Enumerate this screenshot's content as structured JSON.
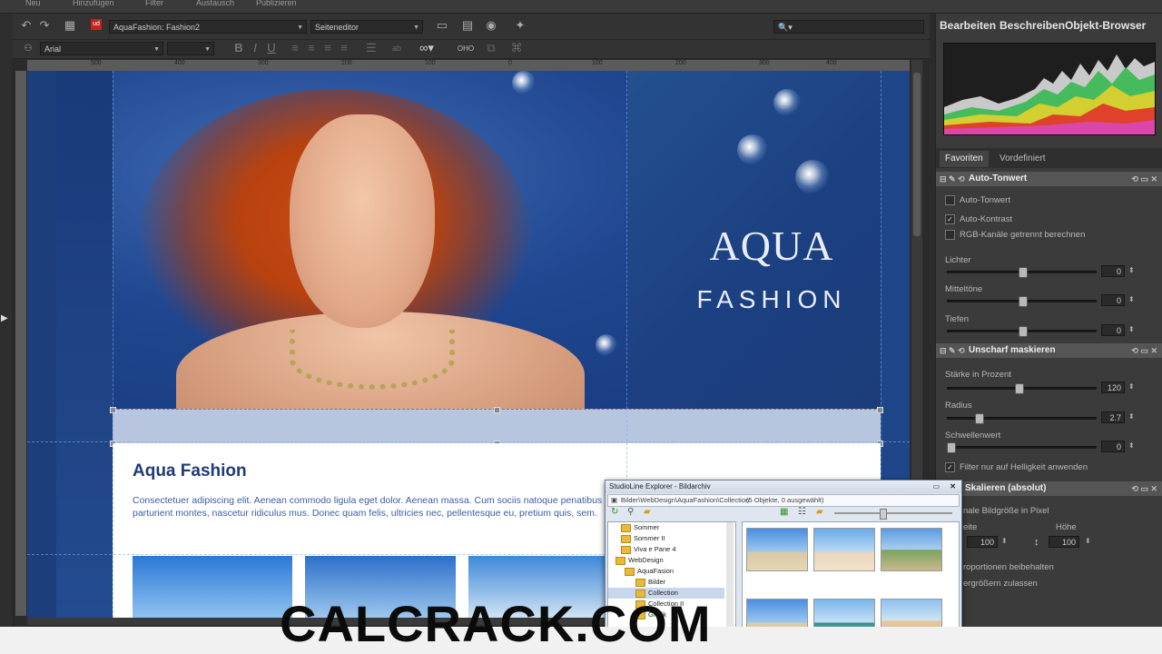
{
  "menubar": {
    "items": [
      "Neu",
      "Hinzufügen",
      "Filter",
      "Austausch",
      "Publizieren"
    ]
  },
  "toolbar": {
    "document_name": "AquaFashion: Fashion2",
    "mode": "Seiteneditor",
    "font": "Arial",
    "ruler_marks": [
      "500",
      "400",
      "300",
      "200",
      "100",
      "0",
      "100",
      "200",
      "300",
      "400"
    ]
  },
  "canvas": {
    "logo_line1": "AQUA",
    "logo_line2": "FASHION",
    "content_title": "Aqua Fashion",
    "content_text": "Consectetuer adipiscing elit. Aenean commodo ligula eget dolor. Aenean massa. Cum sociis natoque penatibus et magnis dis parturient montes, nascetur ridiculus mus. Donec quam felis, ultricies nec, pellentesque eu, pretium quis, sem."
  },
  "right_panel": {
    "tabs": [
      "Bearbeiten",
      "Beschreiben",
      "Objekt-Browser"
    ],
    "favorite_tabs": [
      "Favoriten",
      "Vordefiniert"
    ],
    "auto_tonwert": {
      "title": "Auto-Tonwert",
      "options": [
        {
          "label": "Auto-Tonwert",
          "checked": false
        },
        {
          "label": "Auto-Kontrast",
          "checked": true
        },
        {
          "label": "RGB-Kanäle getrennt berechnen",
          "checked": false
        }
      ],
      "sliders": [
        {
          "label": "Lichter",
          "value": "0",
          "level": 0.5
        },
        {
          "label": "Mitteltöne",
          "value": "0",
          "level": 0.5
        },
        {
          "label": "Tiefen",
          "value": "0",
          "level": 0.5
        }
      ]
    },
    "unscharf": {
      "title": "Unscharf maskieren",
      "sliders": [
        {
          "label": "Stärke in Prozent",
          "value": "120",
          "level": 0.48
        },
        {
          "label": "Radius",
          "value": "2.7",
          "level": 0.2
        },
        {
          "label": "Schwellenwert",
          "value": "0",
          "level": 0.0
        }
      ],
      "filter_option": "Filter nur auf Helligkeit anwenden"
    },
    "skalieren": {
      "title": "Skalieren (absolut)",
      "size_label": "nale Bildgröße in Pixel",
      "width_label": "eite",
      "height_label": "Höhe",
      "width_value": "100",
      "height_value": "100",
      "keep_ratio": "roportionen beibehalten",
      "allow_enlarge": "ergrößern zulassen"
    }
  },
  "explorer": {
    "title": "StudioLine Explorer - Bildarchiv",
    "path": "Bilder\\WebDesign\\AquaFashion\\Collection",
    "count": "(5 Objekte, 0 ausgewählt)",
    "tree": [
      "Sommer",
      "Sommer II",
      "Viva e Pane 4",
      "WebDesign",
      "AquaFasion",
      "Bilder",
      "Collection",
      "Collection II",
      "Grafik"
    ]
  },
  "watermark": {
    "text": "CALCRACK.COM"
  },
  "colors": {
    "app_bg": "#2b2b2b",
    "canvas_blue": "#1c3f7c",
    "title_blue": "#1e3a78",
    "text_blue": "#3b5da6"
  }
}
